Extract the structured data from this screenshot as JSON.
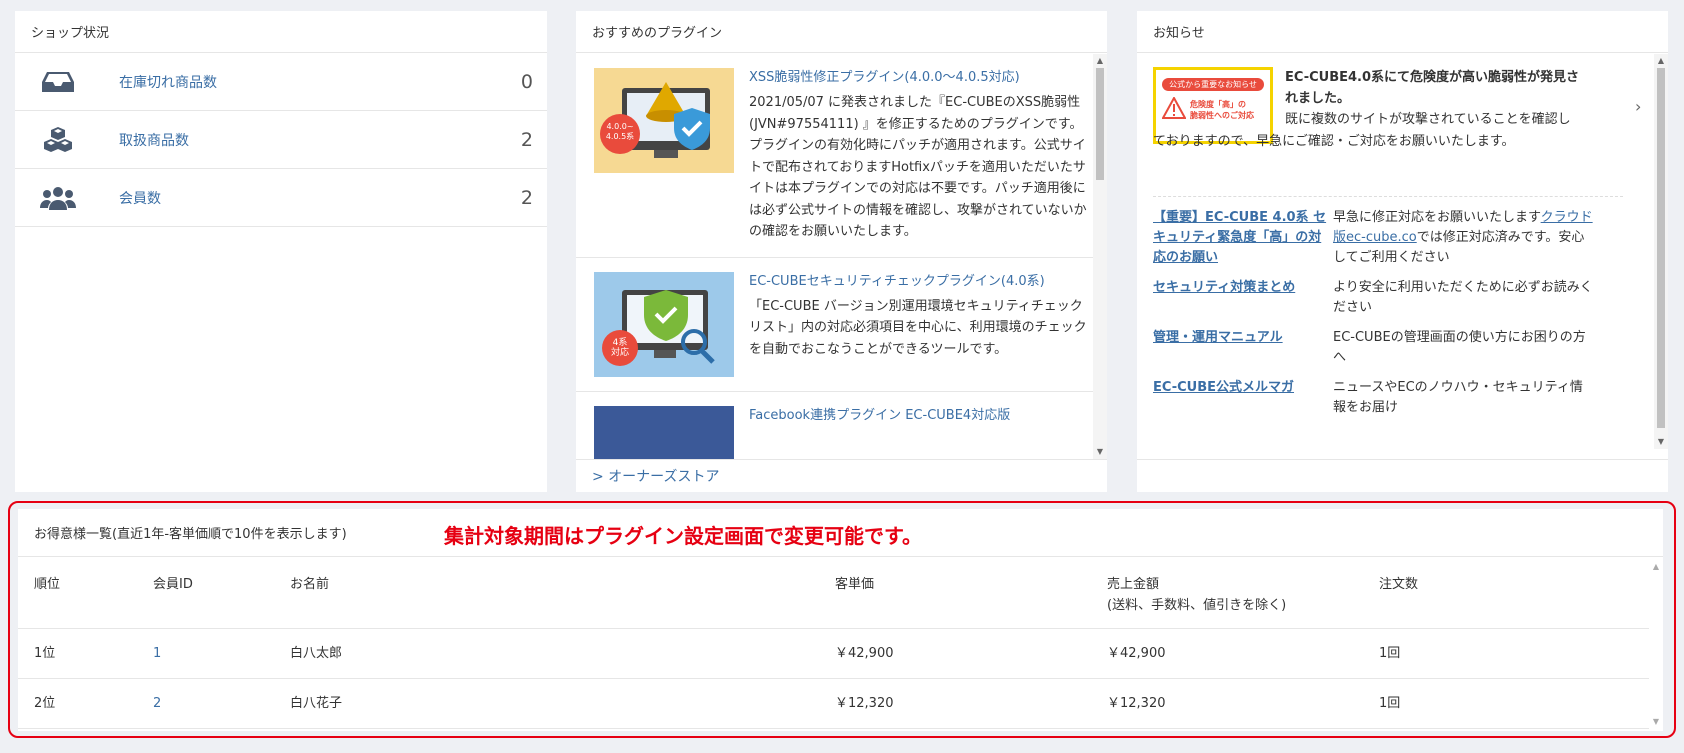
{
  "shop": {
    "title": "ショップ状況",
    "items": [
      {
        "icon": "inbox-icon",
        "label": "在庫切れ商品数",
        "count": "0"
      },
      {
        "icon": "cubes-icon",
        "label": "取扱商品数",
        "count": "2"
      },
      {
        "icon": "users-icon",
        "label": "会員数",
        "count": "2"
      }
    ]
  },
  "plugins": {
    "title": "おすすめのプラグイン",
    "items": [
      {
        "title": "XSS脆弱性修正プラグイン(4.0.0～4.0.5対応)",
        "badge": "4.0.0~\n4.0.5系",
        "desc": "2021/05/07 に発表されました『EC-CUBEのXSS脆弱性 (JVN#97554111) 』を修正するためのプラグインです。プラグインの有効化時にパッチが適用されます。公式サイトで配布されておりますHotfixパッチを適用いただいたサイトは本プラグインでの対応は不要です。パッチ適用後には必ず公式サイトの情報を確認し、攻撃がされていないかの確認をお願いいたします。"
      },
      {
        "title": "EC-CUBEセキュリティチェックプラグイン(4.0系)",
        "badge": "4系\n対応",
        "desc": "「EC-CUBE バージョン別運用環境セキュリティチェックリスト」内の対応必須項目を中心に、利用環境のチェックを自動でおこなうことができるツールです。"
      },
      {
        "title": "Facebook連携プラグイン EC-CUBE4対応版",
        "badge": "",
        "desc": ""
      }
    ],
    "footer_link": "> オーナーズストア"
  },
  "news": {
    "title": "お知らせ",
    "badge_top": "公式から重要なお知らせ",
    "badge_warn": "危険度「高」の\n脆弱性へのご対応",
    "headline": "EC-CUBE4.0系にて危険度が高い脆弱性が発見されました。",
    "body": "既に複数のサイトが攻撃されていることを確認しておりますので、早急にご確認・ご対応をお願いいたします。",
    "links": [
      {
        "label": "【重要】EC-CUBE 4.0系 セキュリティ緊急度「高」の対応のお願い",
        "desc_pre": "早急に修正対応をお願いいたします",
        "desc_link": "クラウド版ec-cube.co",
        "desc_post": "では修正対応済みです。安心してご利用ください"
      },
      {
        "label": "セキュリティ対策まとめ",
        "desc_pre": "より安全に利用いただくために必ずお読みください",
        "desc_link": "",
        "desc_post": ""
      },
      {
        "label": "管理・運用マニュアル",
        "desc_pre": "EC-CUBEの管理画面の使い方にお困りの方へ",
        "desc_link": "",
        "desc_post": ""
      },
      {
        "label": "EC-CUBE公式メルマガ",
        "desc_pre": "ニュースやECのノウハウ・セキュリティ情報をお届け",
        "desc_link": "",
        "desc_post": ""
      }
    ]
  },
  "customers": {
    "title": "お得意様一覧(直近1年-客単価順で10件を表示します)",
    "note": "集計対象期間はプラグイン設定画面で変更可能です。",
    "headers": {
      "rank": "順位",
      "member_id": "会員ID",
      "name": "お名前",
      "unit_price": "客単価",
      "sales": "売上金額",
      "sales_sub": "(送料、手数料、値引きを除く)",
      "orders": "注文数"
    },
    "rows": [
      {
        "rank": "1位",
        "member_id": "1",
        "name": "白八太郎",
        "unit_price": "￥42,900",
        "sales": "￥42,900",
        "orders": "1回"
      },
      {
        "rank": "2位",
        "member_id": "2",
        "name": "白八花子",
        "unit_price": "￥12,320",
        "sales": "￥12,320",
        "orders": "1回"
      }
    ]
  }
}
